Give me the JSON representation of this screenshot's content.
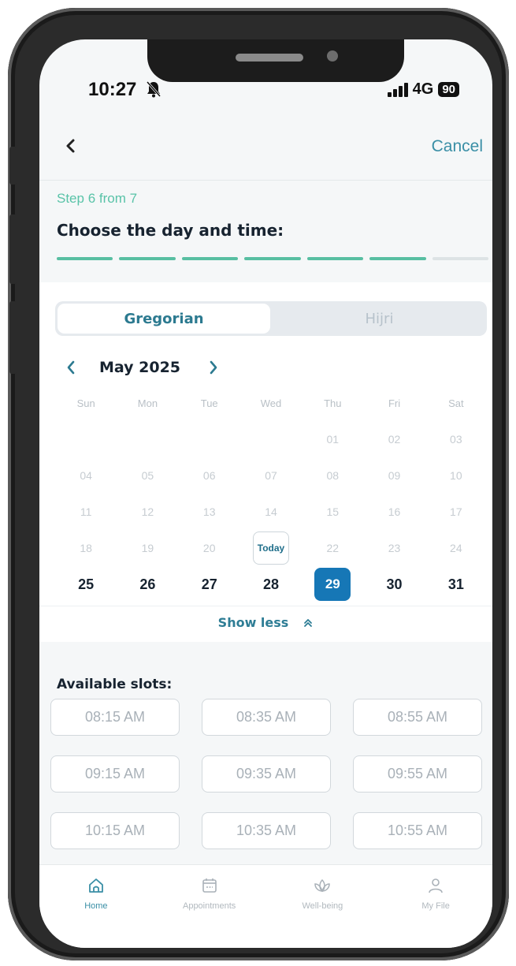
{
  "status_bar": {
    "time": "10:27",
    "network": "4G",
    "battery": "90"
  },
  "header": {
    "cancel_label": "Cancel"
  },
  "step": {
    "label": "Step 6 from 7",
    "title": "Choose the day and time:",
    "current": 6,
    "total": 7
  },
  "calendar": {
    "toggle": {
      "gregorian_label": "Gregorian",
      "hijri_label": "Hijri",
      "selected": "Gregorian"
    },
    "month_label": "May 2025",
    "weekdays": [
      "Sun",
      "Mon",
      "Tue",
      "Wed",
      "Thu",
      "Fri",
      "Sat"
    ],
    "weeks": [
      [
        "",
        "",
        "",
        "",
        "01",
        "02",
        "03"
      ],
      [
        "04",
        "05",
        "06",
        "07",
        "08",
        "09",
        "10"
      ],
      [
        "11",
        "12",
        "13",
        "14",
        "15",
        "16",
        "17"
      ],
      [
        "18",
        "19",
        "20",
        "Today",
        "22",
        "23",
        "24"
      ],
      [
        "25",
        "26",
        "27",
        "28",
        "29",
        "30",
        "31"
      ]
    ],
    "selected_day": "29",
    "show_less_label": "Show less"
  },
  "slots": {
    "title": "Available slots:",
    "times": [
      "08:15 AM",
      "08:35 AM",
      "08:55 AM",
      "09:15 AM",
      "09:35 AM",
      "09:55 AM",
      "10:15 AM",
      "10:35 AM",
      "10:55 AM"
    ]
  },
  "bottom_nav": {
    "items": [
      {
        "label": "Home",
        "icon": "home-icon"
      },
      {
        "label": "Appointments",
        "icon": "calendar-icon"
      },
      {
        "label": "Well-being",
        "icon": "lotus-icon"
      },
      {
        "label": "My File",
        "icon": "user-icon"
      }
    ],
    "current": "Home"
  },
  "colors": {
    "accent": "#3a8fa6",
    "progress": "#58bfa2",
    "selected_day": "#1677b6",
    "title": "#172330"
  }
}
